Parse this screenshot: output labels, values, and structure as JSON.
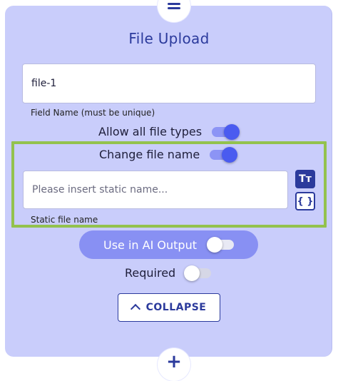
{
  "card": {
    "title": "File Upload",
    "field_name": {
      "value": "file-1",
      "helper": "Field Name (must be unique)"
    },
    "toggles": {
      "allow_all_file_types": {
        "label": "Allow all file types",
        "on": true
      },
      "change_file_name": {
        "label": "Change file name",
        "on": true
      },
      "use_in_ai_output": {
        "label": "Use in AI Output",
        "on": false
      },
      "required": {
        "label": "Required",
        "on": false
      }
    },
    "static_file_name": {
      "placeholder": "Please insert static name...",
      "helper": "Static file name",
      "text_mode_icon": "text-format-icon",
      "code_mode_icon": "curly-braces-icon",
      "text_mode_glyph": "Tт",
      "code_mode_glyph": "{ }"
    },
    "collapse_label": "COLLAPSE",
    "top_handle_icon": "menu-icon",
    "bottom_handle_icon": "plus-icon",
    "bottom_handle_glyph": "+"
  },
  "colors": {
    "panel": "#c9cdfb",
    "accent": "#2b3a9c",
    "toggle_on": "#4a5bf0",
    "pill": "#8890f3",
    "highlight": "#93c24d"
  }
}
